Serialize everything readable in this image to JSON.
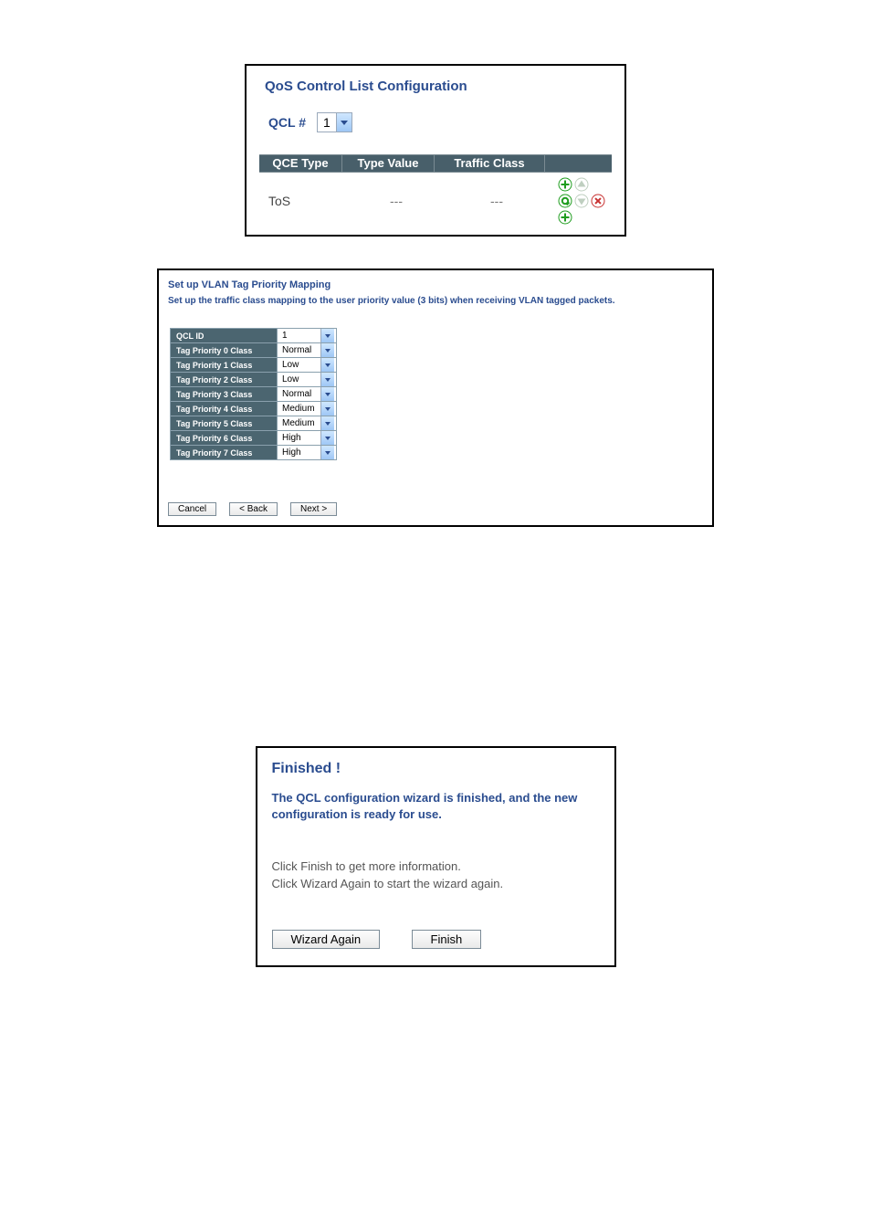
{
  "panel1": {
    "title": "QoS Control List Configuration",
    "qcl_label": "QCL #",
    "qcl_value": "1",
    "headers": {
      "c1": "QCE Type",
      "c2": "Type Value",
      "c3": "Traffic Class"
    },
    "row": {
      "qce_type": "ToS",
      "type_value": "---",
      "traffic_class": "---"
    }
  },
  "panel2": {
    "title": "Set up VLAN Tag Priority Mapping",
    "subtitle": "Set up the traffic class mapping to the user priority value (3 bits) when receiving VLAN tagged packets.",
    "rows": [
      {
        "label": "QCL ID",
        "value": "1"
      },
      {
        "label": "Tag Priority 0 Class",
        "value": "Normal"
      },
      {
        "label": "Tag Priority 1 Class",
        "value": "Low"
      },
      {
        "label": "Tag Priority 2 Class",
        "value": "Low"
      },
      {
        "label": "Tag Priority 3 Class",
        "value": "Normal"
      },
      {
        "label": "Tag Priority 4 Class",
        "value": "Medium"
      },
      {
        "label": "Tag Priority 5 Class",
        "value": "Medium"
      },
      {
        "label": "Tag Priority 6 Class",
        "value": "High"
      },
      {
        "label": "Tag Priority 7 Class",
        "value": "High"
      }
    ],
    "btn_cancel": "Cancel",
    "btn_back": "< Back",
    "btn_next": "Next >"
  },
  "panel3": {
    "title": "Finished !",
    "subtitle": "The QCL configuration wizard is finished, and the new configuration is ready for use.",
    "line1": "Click Finish to get more information.",
    "line2": "Click Wizard Again to start the wizard again.",
    "btn_wizard": "Wizard Again",
    "btn_finish": "Finish"
  }
}
